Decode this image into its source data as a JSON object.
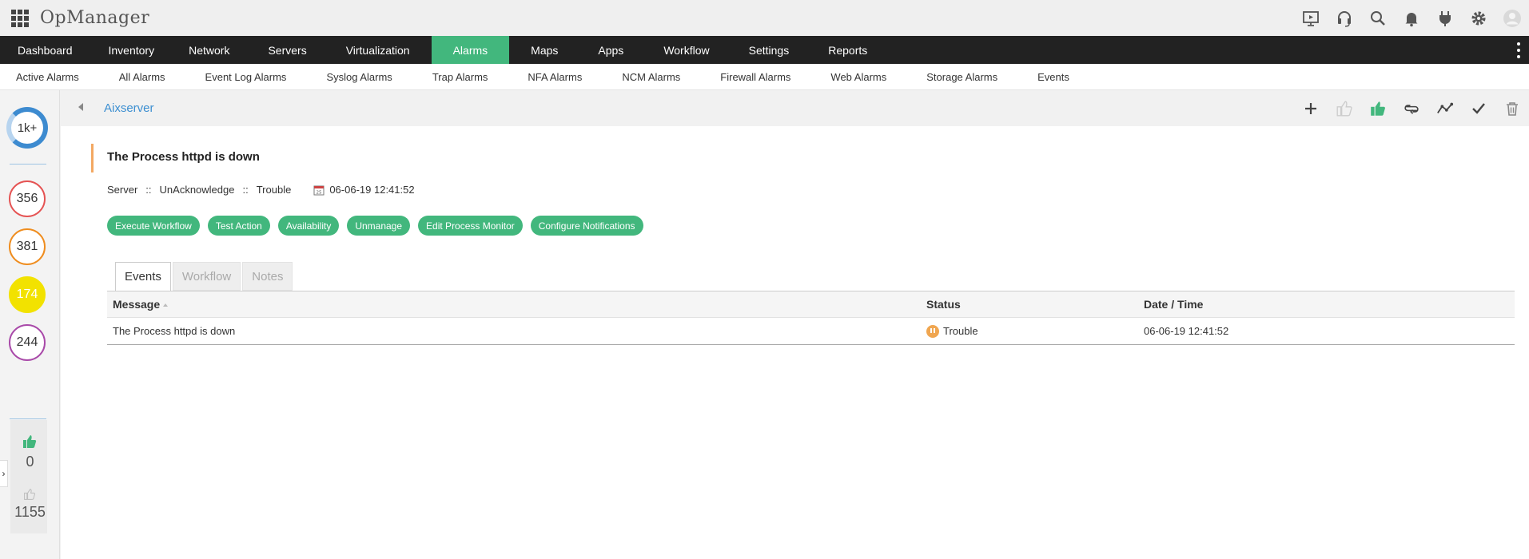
{
  "app": {
    "title": "OpManager"
  },
  "top_icons": [
    "presentation-icon",
    "headset-icon",
    "search-icon",
    "bell-icon",
    "plug-icon",
    "gear-icon",
    "user-avatar-icon"
  ],
  "main_nav": {
    "items": [
      "Dashboard",
      "Inventory",
      "Network",
      "Servers",
      "Virtualization",
      "Alarms",
      "Maps",
      "Apps",
      "Workflow",
      "Settings",
      "Reports"
    ],
    "active": "Alarms"
  },
  "sub_nav": {
    "items": [
      "Active Alarms",
      "All Alarms",
      "Event Log Alarms",
      "Syslog Alarms",
      "Trap Alarms",
      "NFA Alarms",
      "NCM Alarms",
      "Firewall Alarms",
      "Web Alarms",
      "Storage Alarms",
      "Events"
    ]
  },
  "sidebar": {
    "total": "1k+",
    "critical": "356",
    "major": "381",
    "trouble": "174",
    "attention": "244",
    "acknowledged": "0",
    "unacknowledged": "1155"
  },
  "toolbar": {
    "device": "Aixserver",
    "actions": [
      "add-icon",
      "thumbs-up-outline-icon",
      "thumbs-up-icon",
      "loop-icon",
      "graph-icon",
      "check-icon",
      "trash-icon"
    ]
  },
  "alarm": {
    "title": "The Process httpd is down",
    "category": "Server",
    "ack_state": "UnAcknowledge",
    "severity": "Trouble",
    "separator": "::",
    "timestamp": "06-06-19 12:41:52"
  },
  "buttons": [
    "Execute Workflow",
    "Test Action",
    "Availability",
    "Unmanage",
    "Edit Process Monitor",
    "Configure Notifications"
  ],
  "tabs": {
    "items": [
      "Events",
      "Workflow",
      "Notes"
    ],
    "active": "Events"
  },
  "events_table": {
    "headers": [
      "Message",
      "Status",
      "Date / Time"
    ],
    "rows": [
      {
        "message": "The Process httpd is down",
        "status": "Trouble",
        "datetime": "06-06-19 12:41:52"
      }
    ]
  },
  "colors": {
    "accent": "#42b77d",
    "nav_bg": "#222222",
    "link": "#3c8fd1",
    "critical": "#e55353",
    "major": "#ef8d1f",
    "trouble": "#f2e200",
    "attention": "#a94aa9",
    "status_trouble": "#f0a650"
  }
}
